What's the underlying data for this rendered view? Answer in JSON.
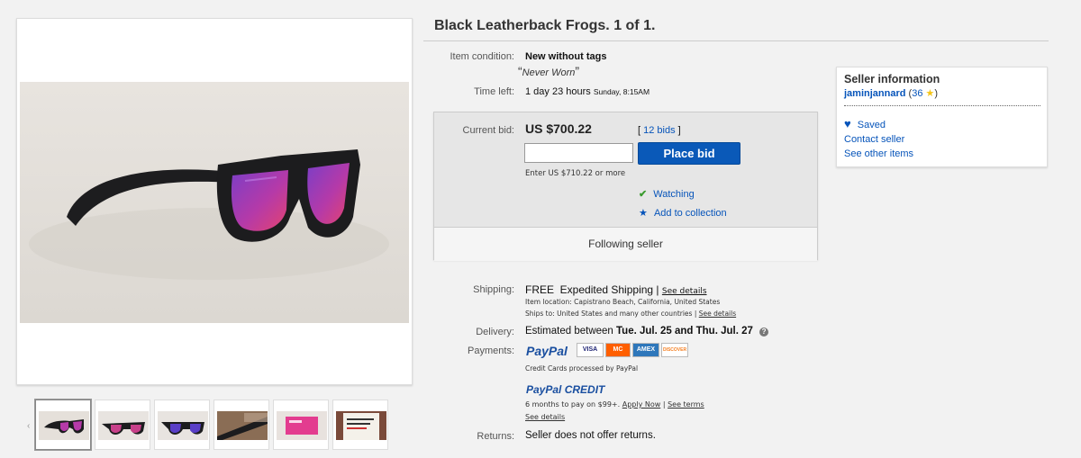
{
  "listing": {
    "title": "Black Leatherback Frogs. 1 of 1."
  },
  "condition": {
    "label": "Item condition:",
    "value": "New without tags",
    "quote": "Never Worn",
    "open_quote": "“",
    "close_quote": "”"
  },
  "time_left": {
    "label": "Time left:",
    "value": "1 day 23 hours",
    "end": "Sunday, 8:15AM"
  },
  "bid": {
    "label": "Current bid:",
    "price": "US $700.22",
    "bids_open": "[",
    "bids_link": "12 bids",
    "bids_close": "]",
    "button": "Place bid",
    "hint": "Enter US $710.22 or more",
    "watching": "Watching",
    "collection": "Add to collection",
    "following": "Following seller"
  },
  "shipping": {
    "label": "Shipping:",
    "value": "FREE  Expedited Shipping |",
    "see_details": "See details",
    "location": "Item location:  Capistrano Beach, California, United States",
    "ships_to": "Ships to:  United States and many other countries |",
    "ships_see_details": "See details"
  },
  "delivery": {
    "label": "Delivery:",
    "prefix": "Estimated between ",
    "range": "Tue. Jul. 25 and Thu. Jul. 27",
    "info_icon": "?"
  },
  "payments": {
    "label": "Payments:",
    "paypal": "PayPal",
    "cards": [
      "VISA",
      "MC",
      "AMEX",
      "DISCOVER"
    ],
    "cards_note": "Credit Cards processed by PayPal",
    "paypal_credit": "PayPal CREDIT",
    "credit_note": "6 months to pay on $99+.",
    "apply_now": "Apply Now",
    "see_terms": "See terms",
    "see_details": "See details",
    "sep": "|"
  },
  "returns": {
    "label": "Returns:",
    "value": "Seller does not offer returns."
  },
  "seller": {
    "heading": "Seller information",
    "name": "jaminjannard",
    "rating_open": "(",
    "rating": "36",
    "rating_close": ")",
    "saved": "Saved",
    "contact": "Contact seller",
    "other_items": "See other items"
  },
  "colors": {
    "link": "#0654ba",
    "button": "#0a59b8",
    "check": "#3a9b2e",
    "star": "#f5c518"
  },
  "gallery": {
    "thumb_count": 6
  }
}
